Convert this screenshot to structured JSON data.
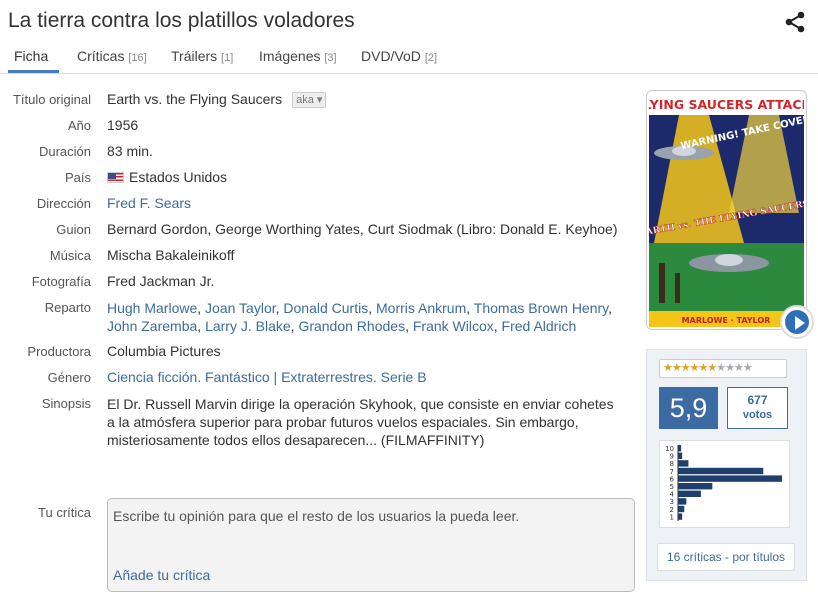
{
  "title": "La tierra contra los platillos voladores",
  "tabs": [
    {
      "label": "Ficha",
      "count": ""
    },
    {
      "label": "Críticas",
      "count": "[16]"
    },
    {
      "label": "Tráilers",
      "count": "[1]"
    },
    {
      "label": "Imágenes",
      "count": "[3]"
    },
    {
      "label": "DVD/VoD",
      "count": "[2]"
    }
  ],
  "details": {
    "titulo_original": {
      "label": "Título original",
      "value": "Earth vs. the Flying Saucers",
      "aka": "aka"
    },
    "anio": {
      "label": "Año",
      "value": "1956"
    },
    "duracion": {
      "label": "Duración",
      "value": "83 min."
    },
    "pais": {
      "label": "País",
      "value": "Estados Unidos"
    },
    "direccion": {
      "label": "Dirección",
      "value": "Fred F. Sears"
    },
    "guion": {
      "label": "Guion",
      "value": "Bernard Gordon, George Worthing Yates, Curt Siodmak (Libro: Donald E. Keyhoe)"
    },
    "musica": {
      "label": "Música",
      "value": "Mischa Bakaleinikoff"
    },
    "fotografia": {
      "label": "Fotografía",
      "value": "Fred Jackman Jr."
    },
    "reparto": {
      "label": "Reparto",
      "actors": [
        "Hugh Marlowe",
        "Joan Taylor",
        "Donald Curtis",
        "Morris Ankrum",
        "Thomas Brown Henry",
        "John Zaremba",
        "Larry J. Blake",
        "Grandon Rhodes",
        "Frank Wilcox",
        "Fred Aldrich"
      ]
    },
    "productora": {
      "label": "Productora",
      "value": "Columbia Pictures"
    },
    "genero": {
      "label": "Género",
      "genre_links": [
        "Ciencia ficción",
        "Fantástico"
      ],
      "separator": "|",
      "tags": [
        "Extraterrestres",
        "Serie B"
      ]
    },
    "sinopsis": {
      "label": "Sinopsis",
      "value": "El Dr. Russell Marvin dirige la operación Skyhook, que consiste en enviar cohetes a la atmósfera superior para probar futuros vuelos espaciales. Sin embargo, misteriosamente todos ellos desaparecen... (FILMAFFINITY)"
    }
  },
  "poster": {
    "headline": "FLYING SAUCERS ATTACK!",
    "tagline": "WARNING! TAKE COVER!",
    "film_title": "EARTH vs. THE FLYING SAUCERS",
    "cast": "MARLOWE · TAYLOR"
  },
  "rating": {
    "stars_filled": 6,
    "stars_total": 10,
    "average": "5,9",
    "votes": "677",
    "votes_label": "votos",
    "histogram": {
      "scale_labels": [
        "10",
        "9",
        "8",
        "7",
        "6",
        "5",
        "4",
        "3",
        "2",
        "1"
      ],
      "values": [
        3,
        4,
        10,
        82,
        100,
        33,
        22,
        8,
        6,
        4
      ]
    },
    "critics_link": "16 críticas - por títulos"
  },
  "tu_critica": {
    "label": "Tu crítica",
    "placeholder": "Escribe tu opinión para que el resto de los usuarios la pueda leer.",
    "add_link": "Añade tu crítica"
  },
  "colors": {
    "accent": "#4a7bbf",
    "link": "#3d6c9e",
    "rating_blue": "#3c6aa3",
    "histogram_bar": "#1f3f6e"
  }
}
